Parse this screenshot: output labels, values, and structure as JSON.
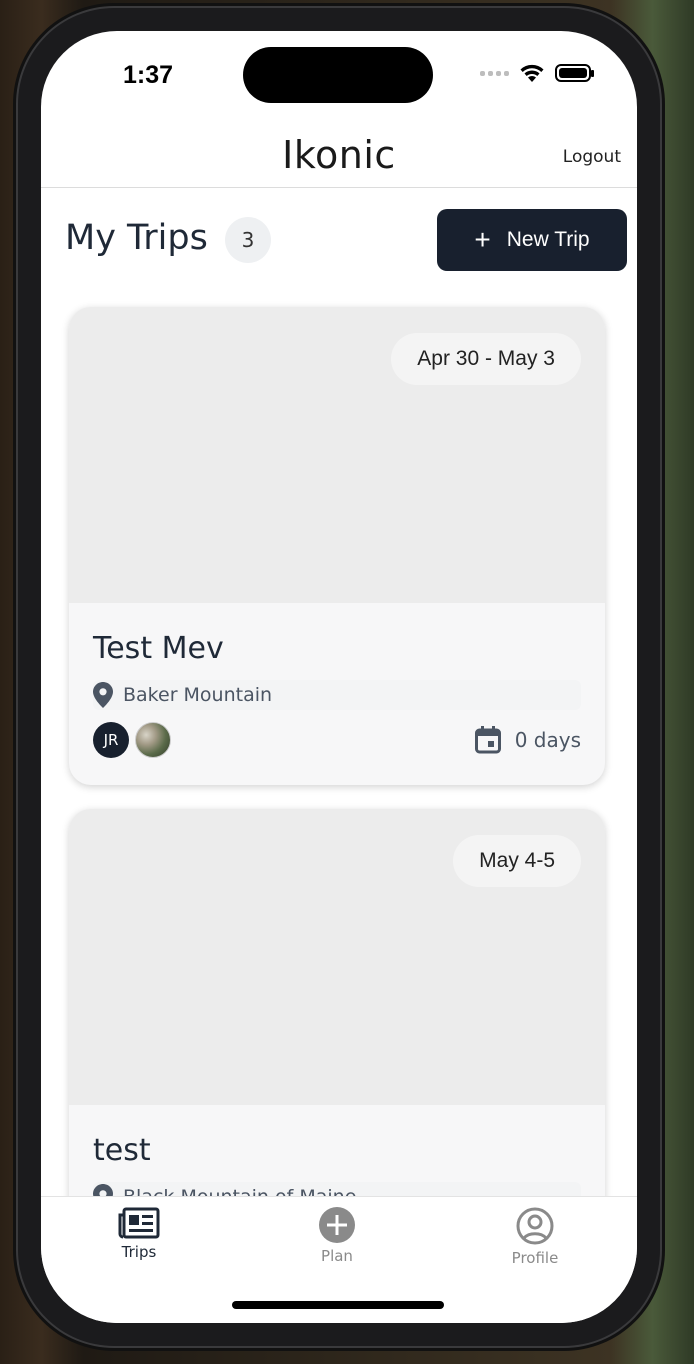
{
  "status_bar": {
    "time": "1:37"
  },
  "header": {
    "title": "Ikonic",
    "logout_label": "Logout"
  },
  "section": {
    "title": "My Trips",
    "count": "3",
    "new_trip_label": "New Trip"
  },
  "trips": [
    {
      "name": "Test Mev",
      "dates": "Apr 30 - May 3",
      "location": "Baker Mountain",
      "avatar_initials": "JR",
      "duration": "0 days"
    },
    {
      "name": "test",
      "dates": "May 4-5",
      "location": "Black Mountain of Maine"
    }
  ],
  "tabs": [
    {
      "label": "Trips",
      "icon": "newspaper-icon",
      "active": true
    },
    {
      "label": "Plan",
      "icon": "plus-circle-icon",
      "active": false
    },
    {
      "label": "Profile",
      "icon": "user-circle-icon",
      "active": false
    }
  ],
  "colors": {
    "primary": "#18202e",
    "card_image_bg": "#ececec",
    "text_muted": "#4b5563",
    "tab_inactive": "#8a8a8a"
  }
}
